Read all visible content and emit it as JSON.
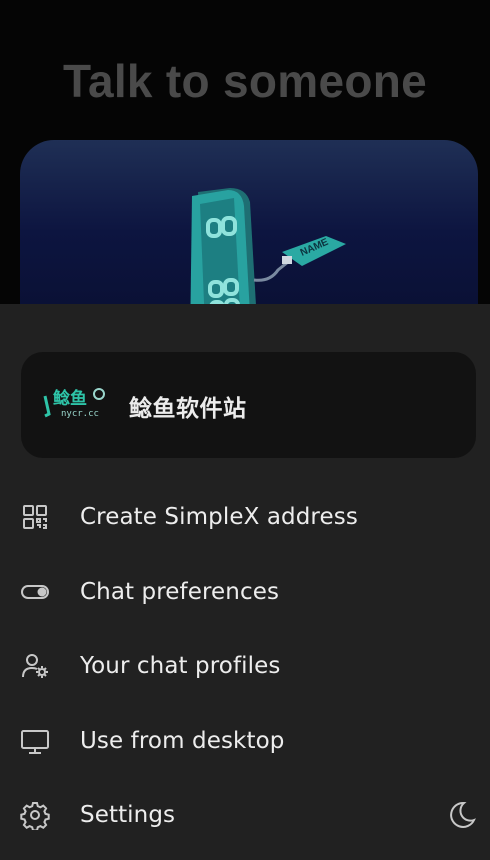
{
  "background": {
    "title": "Talk to someone",
    "hero_badge": "NAME"
  },
  "profile": {
    "name": "鲶鱼软件站",
    "avatar_text": "鲶鱼",
    "avatar_subtext": "nycr.cc"
  },
  "menu": [
    {
      "label": "Create SimpleX address",
      "icon": "qr-code-icon"
    },
    {
      "label": "Chat preferences",
      "icon": "toggle-icon"
    },
    {
      "label": "Your chat profiles",
      "icon": "user-settings-icon"
    },
    {
      "label": "Use from desktop",
      "icon": "desktop-icon"
    },
    {
      "label": "Settings",
      "icon": "gear-icon"
    }
  ],
  "theme_toggle_icon": "moon-icon",
  "colors": {
    "sheet_bg": "#212121",
    "card_bg": "#121212",
    "text": "#ededed",
    "icon": "#c8c8c8",
    "accent": "#2ec4a8"
  }
}
